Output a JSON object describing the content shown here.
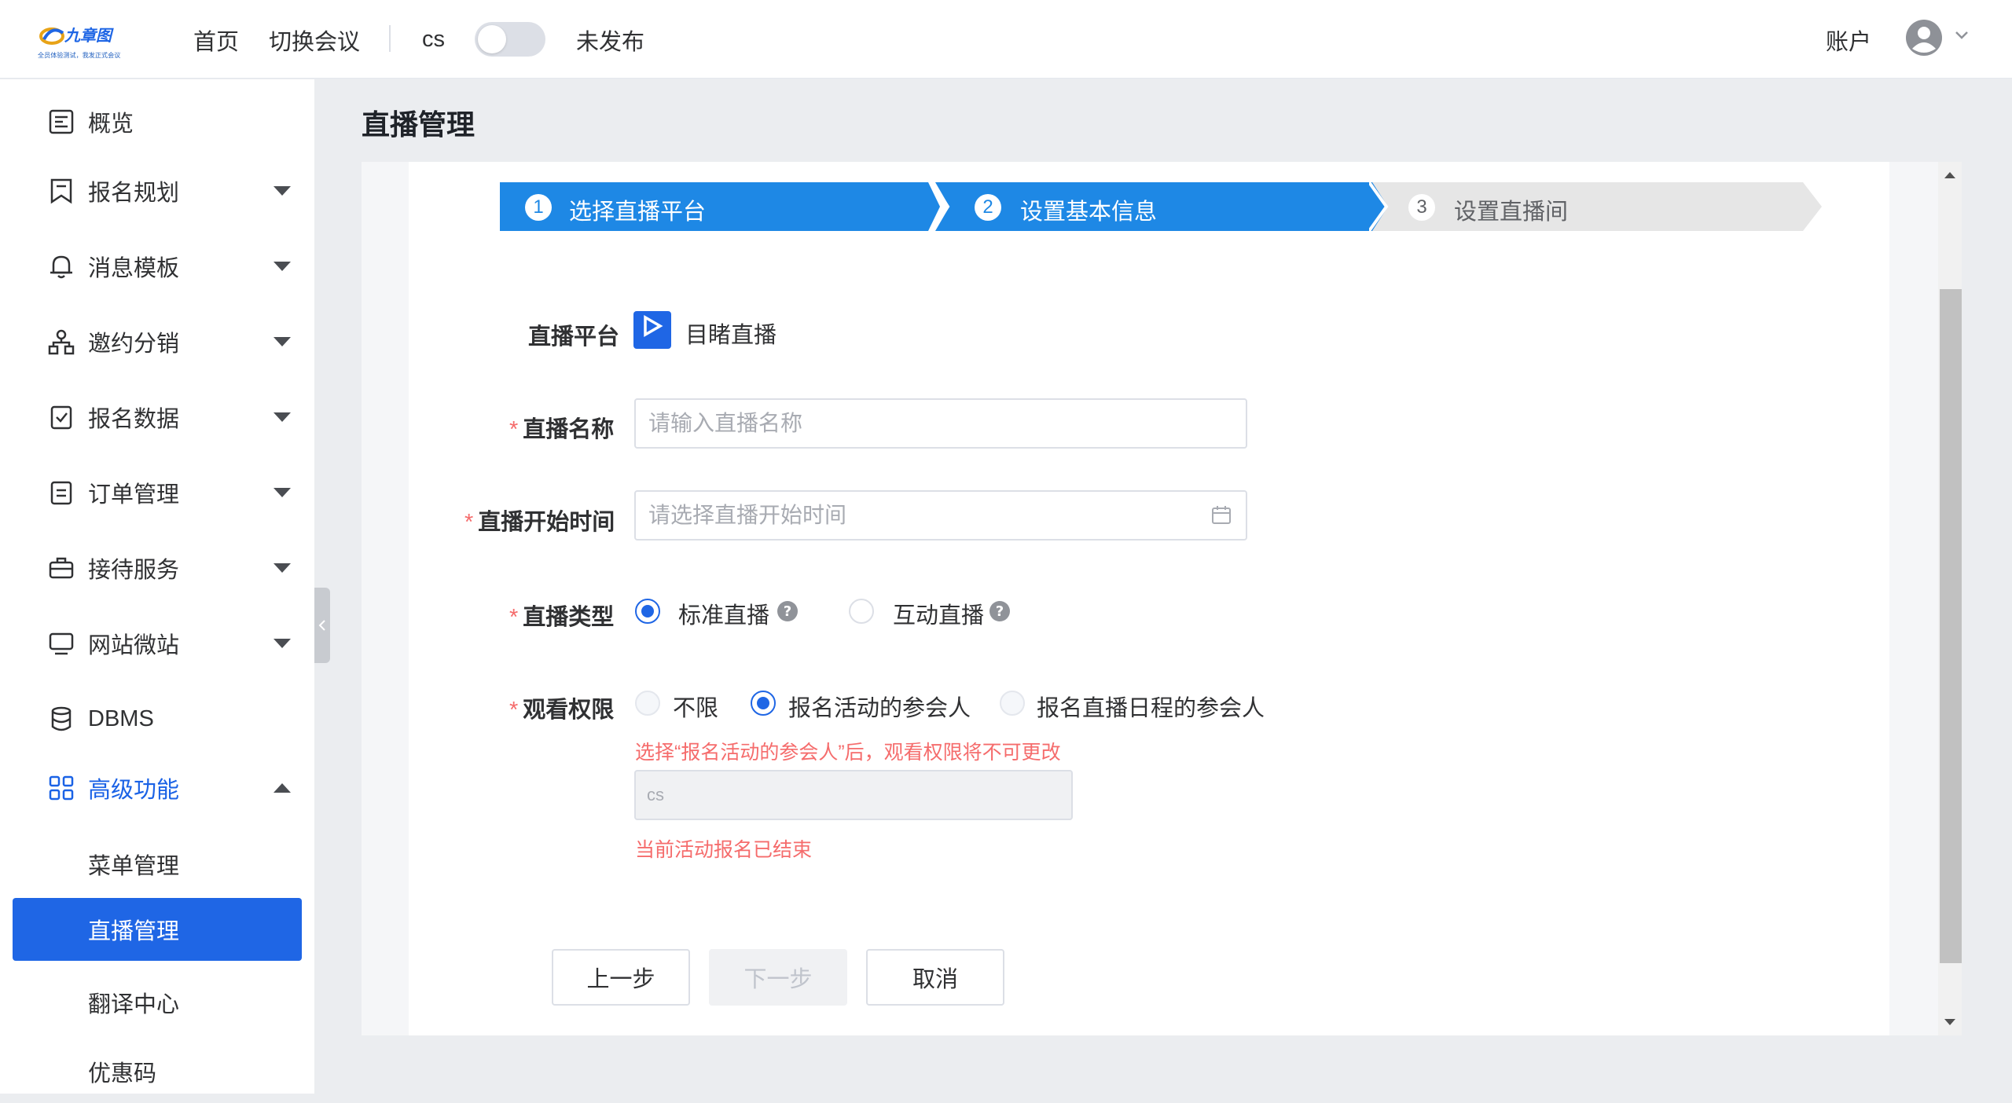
{
  "header": {
    "logo_text": "全员体验测试，我发正式会议",
    "nav": {
      "home": "首页",
      "switch_meeting": "切换会议"
    },
    "conference_code": "cs",
    "publish_toggle": {
      "on": false
    },
    "publish_status": "未发布",
    "account_label": "账户"
  },
  "sidebar": {
    "items": [
      {
        "label": "概览",
        "icon": "overview-icon"
      },
      {
        "label": "报名规划",
        "icon": "bookmark-icon"
      },
      {
        "label": "消息模板",
        "icon": "bell-icon"
      },
      {
        "label": "邀约分销",
        "icon": "org-chart-icon"
      },
      {
        "label": "报名数据",
        "icon": "check-clipboard-icon"
      },
      {
        "label": "订单管理",
        "icon": "list-document-icon"
      },
      {
        "label": "接待服务",
        "icon": "briefcase-icon"
      },
      {
        "label": "网站微站",
        "icon": "monitor-icon"
      },
      {
        "label": "DBMS",
        "icon": "database-icon"
      },
      {
        "label": "高级功能",
        "icon": "grid-icon"
      }
    ],
    "submenu": [
      {
        "label": "菜单管理"
      },
      {
        "label": "直播管理",
        "selected": true
      },
      {
        "label": "翻译中心"
      },
      {
        "label": "优惠码"
      }
    ]
  },
  "main": {
    "page_title": "直播管理",
    "steps": [
      {
        "num": "1",
        "label": "选择直播平台",
        "state": "done"
      },
      {
        "num": "2",
        "label": "设置基本信息",
        "state": "active"
      },
      {
        "num": "3",
        "label": "设置直播间",
        "state": "pending"
      }
    ],
    "form": {
      "platform_label": "直播平台",
      "platform_name": "目睹直播",
      "platform_icon_caption": "目睹直播",
      "name_label": "直播名称",
      "name_placeholder": "请输入直播名称",
      "start_time_label": "直播开始时间",
      "start_time_placeholder": "请选择直播开始时间",
      "type_label": "直播类型",
      "type_options": [
        "标准直播",
        "互动直播"
      ],
      "type_selected": "标准直播",
      "permission_label": "观看权限",
      "permission_options": [
        "不限",
        "报名活动的参会人",
        "报名直播日程的参会人"
      ],
      "permission_selected": "报名活动的参会人",
      "permission_warning": "选择“报名活动的参会人”后，观看权限将不可更改",
      "event_value": "cs",
      "event_warning": "当前活动报名已结束"
    },
    "buttons": {
      "prev": "上一步",
      "next": "下一步",
      "cancel": "取消"
    }
  },
  "colors": {
    "primary": "#1f66e5",
    "step_active": "#1e88e5",
    "danger": "#f56c6c",
    "page_bg": "#ebedf0"
  }
}
